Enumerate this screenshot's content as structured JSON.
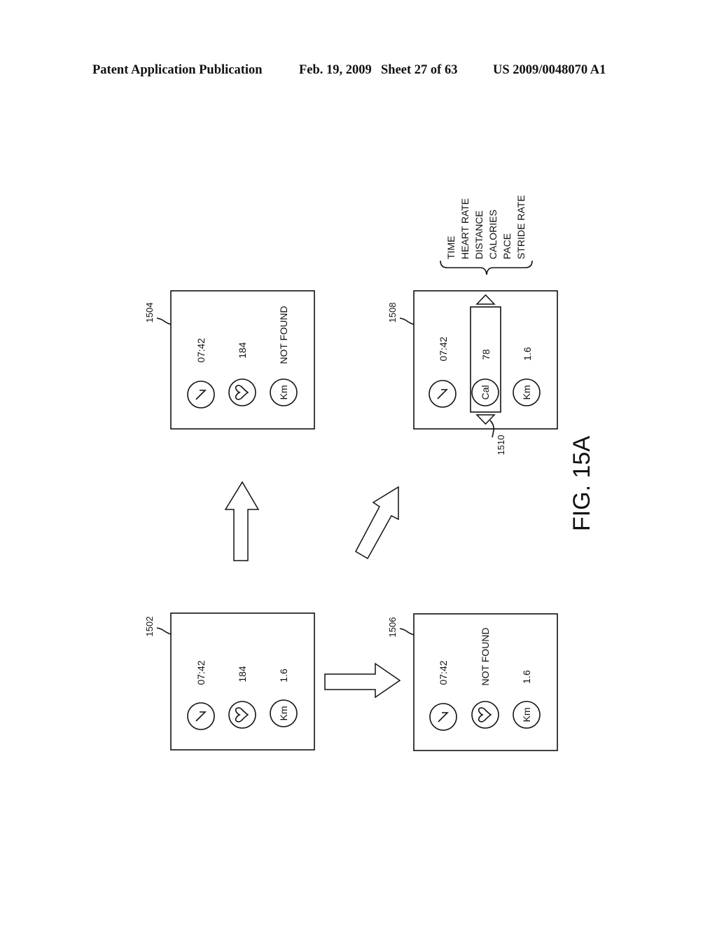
{
  "header": {
    "left": "Patent Application Publication",
    "date": "Feb. 19, 2009",
    "sheet": "Sheet 27 of 63",
    "number": "US 2009/0048070 A1"
  },
  "figure": {
    "label": "FIG. 15A",
    "panels": {
      "p1502": {
        "ref": "1502",
        "rows": [
          {
            "icon": "timer-icon",
            "icon_text": "7",
            "value": "07:42"
          },
          {
            "icon": "heart-icon",
            "icon_text": "",
            "value": "184"
          },
          {
            "icon": "km-icon",
            "icon_text": "Km",
            "value": "1.6"
          }
        ]
      },
      "p1504": {
        "ref": "1504",
        "rows": [
          {
            "icon": "timer-icon",
            "icon_text": "7",
            "value": "07:42"
          },
          {
            "icon": "heart-icon",
            "icon_text": "",
            "value": "184"
          },
          {
            "icon": "km-icon",
            "icon_text": "Km",
            "value": "NOT FOUND"
          }
        ]
      },
      "p1506": {
        "ref": "1506",
        "rows": [
          {
            "icon": "timer-icon",
            "icon_text": "7",
            "value": "07:42"
          },
          {
            "icon": "heart-icon",
            "icon_text": "",
            "value": "NOT FOUND"
          },
          {
            "icon": "km-icon",
            "icon_text": "Km",
            "value": "1.6"
          }
        ]
      },
      "p1508": {
        "ref": "1508",
        "selector_ref": "1510",
        "rows": [
          {
            "icon": "timer-icon",
            "icon_text": "7",
            "value": "07:42"
          },
          {
            "icon": "cal-icon",
            "icon_text": "Cal",
            "value": "78"
          },
          {
            "icon": "km-icon",
            "icon_text": "Km",
            "value": "1.6"
          }
        ],
        "options": [
          "TIME",
          "HEART RATE",
          "DISTANCE",
          "CALORIES",
          "PACE",
          "STRIDE RATE"
        ]
      }
    }
  }
}
